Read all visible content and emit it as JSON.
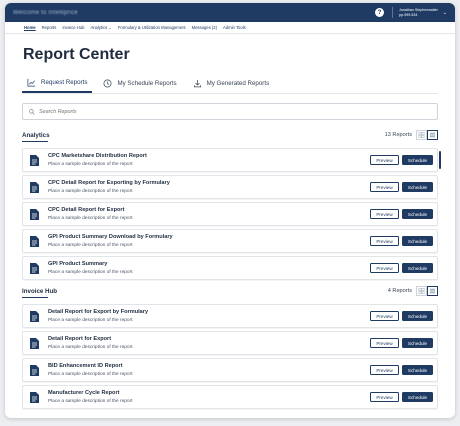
{
  "header": {
    "logo_text": "Welcome to Intelliprice",
    "help_label": "?",
    "user_name": "Jonathan Stephenwalter",
    "user_sub": "pp-999-534"
  },
  "nav": {
    "items": [
      "Home",
      "Reports",
      "Invoice Hub",
      "Analytics ⌄",
      "Formulary & Utilization Management",
      "Messages (2)",
      "Admin Tools"
    ]
  },
  "page": {
    "title": "Report Center"
  },
  "tabs": [
    {
      "label": "Request Reports",
      "icon": "trend-chart-icon"
    },
    {
      "label": "My Schedule Reports",
      "icon": "clock-icon"
    },
    {
      "label": "My Generated Reports",
      "icon": "download-icon"
    }
  ],
  "search": {
    "placeholder": "Search Reports"
  },
  "sections": [
    {
      "title": "Analytics",
      "count": "13 Reports",
      "reports": [
        {
          "title": "CPC Marketshare Distribution Report",
          "desc": "Place a sample description of the report"
        },
        {
          "title": "CPC Detail Report for Exporting by Formulary",
          "desc": "Place a sample description of the report"
        },
        {
          "title": "CPC Detail Report for Export",
          "desc": "Place a sample description of the report"
        },
        {
          "title": "GPI Product Summary Download by Formulary",
          "desc": "Place a sample description of the report"
        },
        {
          "title": "GPI Product Summary",
          "desc": "Place a sample description of the report"
        }
      ]
    },
    {
      "title": "Invoice Hub",
      "count": "4 Reports",
      "reports": [
        {
          "title": "Detail Report for Export by Formulary",
          "desc": "Place a sample description of the report"
        },
        {
          "title": "Detail Report for Export",
          "desc": "Place a sample description of the report"
        },
        {
          "title": "BID Enhancement ID Report",
          "desc": "Place a sample description of the report"
        },
        {
          "title": "Manufacturer Cycle Report",
          "desc": "Place a sample description of the report"
        }
      ]
    }
  ],
  "buttons": {
    "preview": "Preview",
    "schedule": "Schedule"
  },
  "colors": {
    "navy": "#1f3b63",
    "topbar": "#1f3b63",
    "text": "#1f2c40"
  }
}
